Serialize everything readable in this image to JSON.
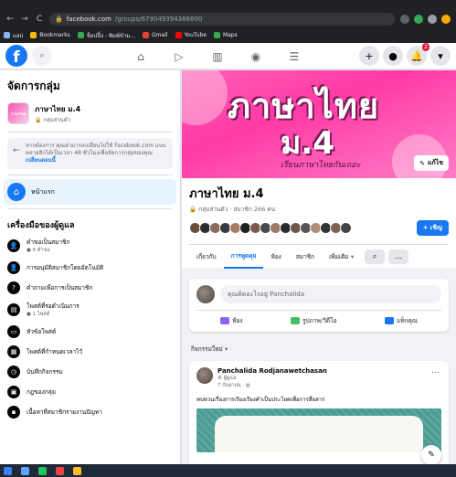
{
  "browser": {
    "url_host": "facebook.com",
    "url_path": "/groups/679049394386800",
    "bookmarks": [
      {
        "label": "แอป",
        "color": "#8ab4f8"
      },
      {
        "label": "Bookmarks",
        "color": "#fbbc04"
      },
      {
        "label": "ช็อปปิ้ง - พิมพ์ข้าม...",
        "color": "#34a853"
      },
      {
        "label": "Gmail",
        "color": "#ea4335"
      },
      {
        "label": "YouTube",
        "color": "#ff0000"
      },
      {
        "label": "Maps",
        "color": "#34a853"
      }
    ]
  },
  "fb": {
    "logo": "f",
    "notif_count": "2"
  },
  "sidebar": {
    "title": "จัดการกลุ่ม",
    "group_name": "ภาษาไทย ม.4",
    "group_privacy": "กลุ่มส่วนตัว",
    "thumb_text": "ภาษาไทย",
    "notice_text": "หากต้องการ คุณสามารถเปลี่ยนไปใช้ Facebook.com แบบคลาสสิกได้เป็นเวลา 48 ชั่วโมงเพื่อจัดการกลุ่มของคุณ",
    "notice_link": "เปลี่ยนตอนนี้",
    "home_label": "หน้าแรก",
    "tools_title": "เครื่องมือของผู้ดูแล",
    "items": [
      {
        "label": "คำขอเป็นสมาชิก",
        "sub": "6 คำขอ",
        "icon": "👤"
      },
      {
        "label": "การอนุมัติสมาชิกโดยอัตโนมัติ",
        "sub": "",
        "icon": "👤"
      },
      {
        "label": "คำถามเพื่อการเป็นสมาชิก",
        "sub": "",
        "icon": "?"
      },
      {
        "label": "โพสต์ที่รอดำเนินการ",
        "sub": "1 โพสต์",
        "icon": "▤"
      },
      {
        "label": "หัวข้อโพสต์",
        "sub": "",
        "icon": "▭"
      },
      {
        "label": "โพสต์ที่กำหนดเวลาไว้",
        "sub": "",
        "icon": "▦"
      },
      {
        "label": "บันทึกกิจกรรม",
        "sub": "",
        "icon": "◷"
      },
      {
        "label": "กฎของกลุ่ม",
        "sub": "",
        "icon": "▣"
      },
      {
        "label": "เนื้อหาที่สมาชิกรายงานปัญหา",
        "sub": "",
        "icon": "▪"
      }
    ]
  },
  "cover": {
    "line1": "ภาษาไทย",
    "line2": "ม.4",
    "tagline": "เรียนภาษาไทยกันเถอะ",
    "edit_label": "แก้ไข"
  },
  "group": {
    "name": "ภาษาไทย ม.4",
    "meta": "กลุ่มส่วนตัว · สมาชิก 266 คน",
    "invite_label": "+ เชิญ",
    "tabs": [
      "เกี่ยวกับ",
      "การพูดคุย",
      "ห้อง",
      "สมาชิก",
      "เพิ่มเติม ▾"
    ],
    "active_tab": 1
  },
  "composer": {
    "placeholder": "คุณคิดอะไรอยู่ Panchalida",
    "actions": [
      {
        "label": "ห้อง",
        "color": "#9360f7"
      },
      {
        "label": "รูปภาพ/วิดีโอ",
        "color": "#45bd62"
      },
      {
        "label": "แท็กคุณ",
        "color": "#1877f2"
      }
    ]
  },
  "activity_label": "กิจกรรมใหม่ ▾",
  "post": {
    "author": "Panchalida Rodjanawetchasan",
    "role": "ผู้ดูแล",
    "time": "7 กันยายน ·",
    "text": "ทบทวนเรื่องการเรียงเรียงคำเป็นประโยคเพื่อการสื่อสาร"
  }
}
